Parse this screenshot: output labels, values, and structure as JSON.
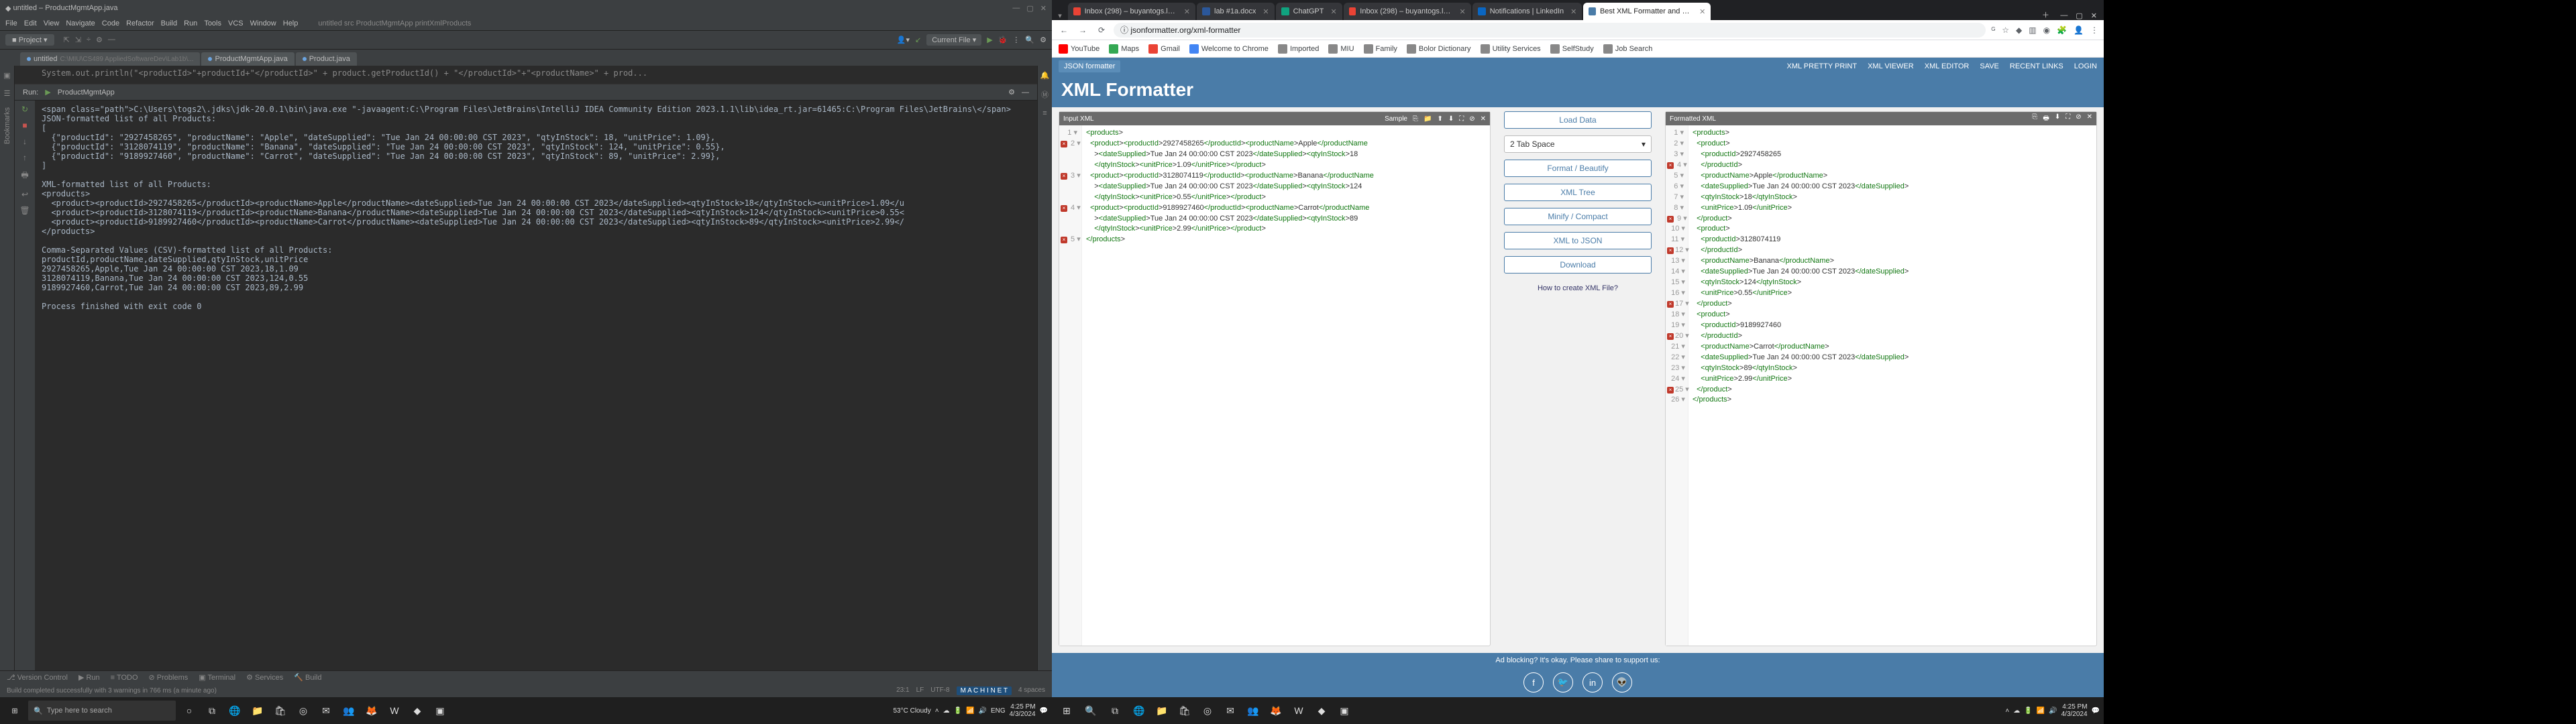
{
  "ij": {
    "title": "untitled – ProductMgmtApp.java",
    "menu": [
      "File",
      "Edit",
      "View",
      "Navigate",
      "Code",
      "Refactor",
      "Build",
      "Run",
      "Tools",
      "VCS",
      "Window",
      "Help"
    ],
    "crumb": "untitled  src  ProductMgmtApp  printXmlProducts",
    "project_label": "Project",
    "current_file": "Current File",
    "tabs": [
      {
        "name": "untitled",
        "path": "C:\\MIU\\CS489 AppliedSoftwareDev\\Lab1b\\..."
      },
      {
        "name": "ProductMgmtApp.java"
      },
      {
        "name": "Product.java"
      }
    ],
    "code_top": "System.out.println(\"<productId>\"+productId+\"</productId>\" + product.getProductId() + \"</productId>\"+\"<productName>\" + prod...",
    "run_label": "Run:",
    "run_target": "ProductMgmtApp",
    "console_path": "C:\\Users\\togs2\\.jdks\\jdk-20.0.1\\bin\\java.exe \"-javaagent:C:\\Program Files\\JetBrains\\IntelliJ IDEA Community Edition 2023.1.1\\lib\\idea_rt.jar=61465:C:\\Program Files\\JetBrains\\",
    "json_hdr": "JSON-formatted list of all Products:",
    "json_rows": [
      "{\"productId\": \"2927458265\", \"productName\": \"Apple\", \"dateSupplied\": \"Tue Jan 24 00:00:00 CST 2023\", \"qtyInStock\": 18, \"unitPrice\": 1.09},",
      "{\"productId\": \"3128074119\", \"productName\": \"Banana\", \"dateSupplied\": \"Tue Jan 24 00:00:00 CST 2023\", \"qtyInStock\": 124, \"unitPrice\": 0.55},",
      "{\"productId\": \"9189927460\", \"productName\": \"Carrot\", \"dateSupplied\": \"Tue Jan 24 00:00:00 CST 2023\", \"qtyInStock\": 89, \"unitPrice\": 2.99},"
    ],
    "xml_hdr": "XML-formatted list of all Products:",
    "xml_open": "<products>",
    "xml_rows": [
      "<product><productId>2927458265</productId><productName>Apple</productName><dateSupplied>Tue Jan 24 00:00:00 CST 2023</dateSupplied><qtyInStock>18</qtyInStock><unitPrice>1.09</u",
      "<product><productId>3128074119</productId><productName>Banana</productName><dateSupplied>Tue Jan 24 00:00:00 CST 2023</dateSupplied><qtyInStock>124</qtyInStock><unitPrice>0.55<",
      "<product><productId>9189927460</productId><productName>Carrot</productName><dateSupplied>Tue Jan 24 00:00:00 CST 2023</dateSupplied><qtyInStock>89</qtyInStock><unitPrice>2.99</"
    ],
    "xml_close": "</products>",
    "csv_hdr": "Comma-Separated Values (CSV)-formatted list of all Products:",
    "csv_cols": "productId,productName,dateSupplied,qtyInStock,unitPrice",
    "csv_rows": [
      "2927458265,Apple,Tue Jan 24 00:00:00 CST 2023,18,1.09",
      "3128074119,Banana,Tue Jan 24 00:00:00 CST 2023,124,0.55",
      "9189927460,Carrot,Tue Jan 24 00:00:00 CST 2023,89,2.99"
    ],
    "exit": "Process finished with exit code 0",
    "bottom_tabs": [
      "Version Control",
      "Run",
      "TODO",
      "Problems",
      "Terminal",
      "Services",
      "Build"
    ],
    "status_msg": "Build completed successfully with 3 warnings in 766 ms (a minute ago)",
    "status_right": [
      "23:1",
      "LF",
      "UTF-8",
      "M A C H I N E T",
      "4 spaces"
    ],
    "search_ph": "Type here to search",
    "weather": "53°C  Cloudy",
    "clock_time": "4:25 PM",
    "clock_date": "4/3/2024",
    "lang": "ENG"
  },
  "chrome": {
    "tabs": [
      {
        "label": "Inbox (298) – buyantogs.luu@...",
        "fav": "#ea4335"
      },
      {
        "label": "lab #1a.docx",
        "fav": "#2b579a"
      },
      {
        "label": "ChatGPT",
        "fav": "#10a37f"
      },
      {
        "label": "Inbox (298) – buyantogs.luu@...",
        "fav": "#ea4335"
      },
      {
        "label": "Notifications | LinkedIn",
        "fav": "#0a66c2"
      },
      {
        "label": "Best XML Formatter and XML ...",
        "fav": "#4a7ca8",
        "active": true
      }
    ],
    "url": "jsonformatter.org/xml-formatter",
    "bookmarks": [
      {
        "label": "YouTube",
        "color": "#ff0000"
      },
      {
        "label": "Maps",
        "color": "#34a853"
      },
      {
        "label": "Gmail",
        "color": "#ea4335"
      },
      {
        "label": "Welcome to Chrome",
        "color": "#4285f4"
      },
      {
        "label": "Imported",
        "color": "#888"
      },
      {
        "label": "MIU",
        "color": "#888"
      },
      {
        "label": "Family",
        "color": "#888"
      },
      {
        "label": "Bolor Dictionary",
        "color": "#888"
      },
      {
        "label": "Utility Services",
        "color": "#888"
      },
      {
        "label": "SelfStudy",
        "color": "#888"
      },
      {
        "label": "Job Search",
        "color": "#888"
      }
    ]
  },
  "site": {
    "brand": "JSON formatter",
    "nav": [
      "XML PRETTY PRINT",
      "XML VIEWER",
      "XML EDITOR",
      "SAVE",
      "RECENT LINKS",
      "LOGIN"
    ],
    "h1": "XML Formatter",
    "input_title": "Input XML",
    "input_sample": "Sample",
    "output_title": "Formatted XML",
    "buttons": {
      "load": "Load Data",
      "tab": "2 Tab Space",
      "format": "Format / Beautify",
      "tree": "XML Tree",
      "minify": "Minify / Compact",
      "tojson": "XML to JSON",
      "download": "Download"
    },
    "howto": "How to create XML File?",
    "adblock": "Ad blocking? It's okay. Please share to support us:",
    "input_lines": [
      "<products>",
      "  <product><productId>2927458265</productId><productName>Apple</productName",
      "    ><dateSupplied>Tue Jan 24 00:00:00 CST 2023</dateSupplied><qtyInStock>18",
      "    </qtyInStock><unitPrice>1.09</unitPrice></product>",
      "  <product><productId>3128074119</productId><productName>Banana</productName",
      "    ><dateSupplied>Tue Jan 24 00:00:00 CST 2023</dateSupplied><qtyInStock>124",
      "    </qtyInStock><unitPrice>0.55</unitPrice></product>",
      "  <product><productId>9189927460</productId><productName>Carrot</productName",
      "    ><dateSupplied>Tue Jan 24 00:00:00 CST 2023</dateSupplied><qtyInStock>89",
      "    </qtyInStock><unitPrice>2.99</unitPrice></product>",
      "</products>"
    ],
    "input_nums": [
      "1",
      "2",
      "",
      "",
      "3",
      "",
      "",
      "4",
      "",
      "",
      "5"
    ],
    "input_err": [
      false,
      true,
      false,
      false,
      true,
      false,
      false,
      true,
      false,
      false,
      true
    ],
    "output_lines": [
      "<products>",
      "  <product>",
      "    <productId>2927458265",
      "    </productId>",
      "    <productName>Apple</productName>",
      "    <dateSupplied>Tue Jan 24 00:00:00 CST 2023</dateSupplied>",
      "    <qtyInStock>18</qtyInStock>",
      "    <unitPrice>1.09</unitPrice>",
      "  </product>",
      "  <product>",
      "    <productId>3128074119",
      "    </productId>",
      "    <productName>Banana</productName>",
      "    <dateSupplied>Tue Jan 24 00:00:00 CST 2023</dateSupplied>",
      "    <qtyInStock>124</qtyInStock>",
      "    <unitPrice>0.55</unitPrice>",
      "  </product>",
      "  <product>",
      "    <productId>9189927460",
      "    </productId>",
      "    <productName>Carrot</productName>",
      "    <dateSupplied>Tue Jan 24 00:00:00 CST 2023</dateSupplied>",
      "    <qtyInStock>89</qtyInStock>",
      "    <unitPrice>2.99</unitPrice>",
      "  </product>",
      "</products>"
    ],
    "output_err": [
      false,
      false,
      false,
      true,
      false,
      false,
      false,
      false,
      true,
      false,
      false,
      true,
      false,
      false,
      false,
      false,
      true,
      false,
      false,
      true,
      false,
      false,
      false,
      false,
      true,
      false
    ]
  }
}
